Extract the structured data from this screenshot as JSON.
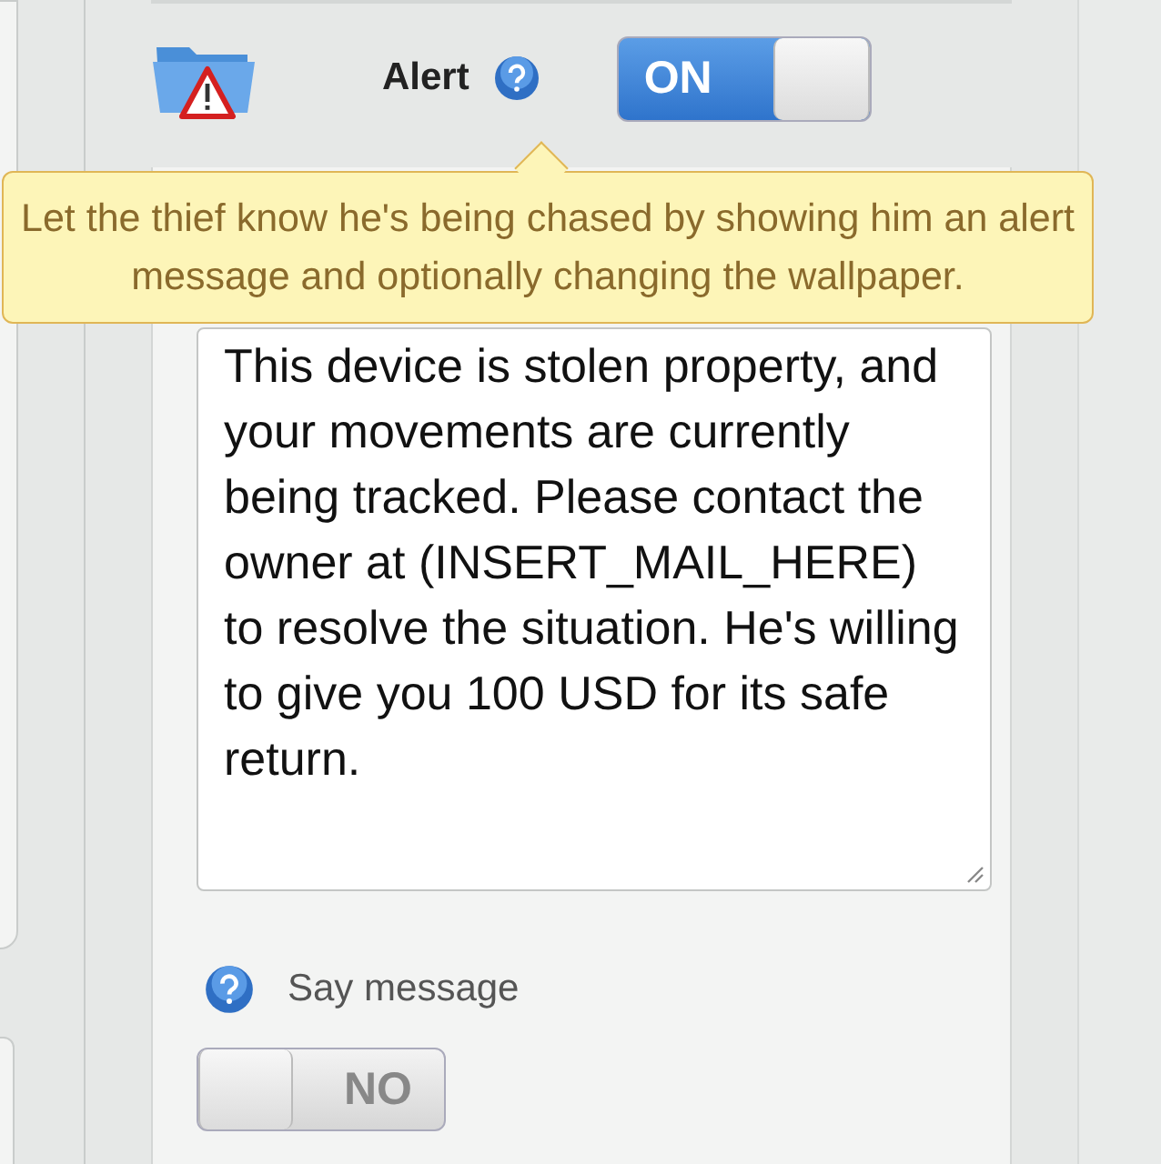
{
  "alert": {
    "label": "Alert",
    "toggle": {
      "on": true,
      "on_text": "ON"
    }
  },
  "tooltip": {
    "text": "Let the thief know he's being chased by showing him an alert message and optionally changing the wallpaper."
  },
  "message": {
    "value": "This device is stolen property, and your movements are currently being tracked. Please contact the owner at (INSERT_MAIL_HERE) to resolve the situation. He's willing to give you 100 USD for its safe return."
  },
  "say_message": {
    "label": "Say message",
    "toggle": {
      "on": false,
      "off_text": "NO"
    }
  }
}
